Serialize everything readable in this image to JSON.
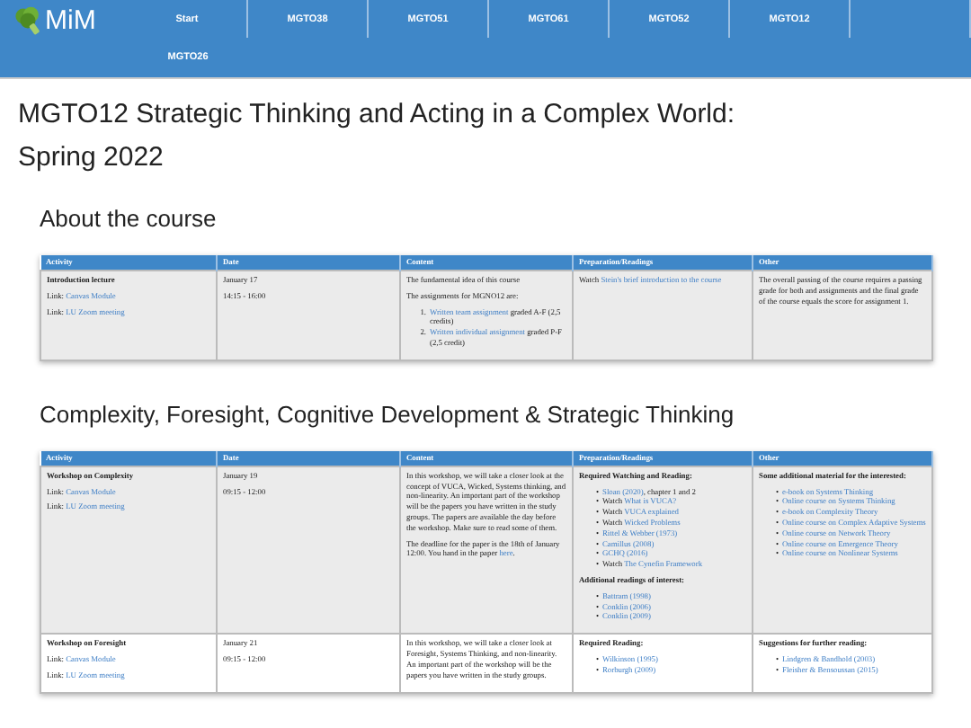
{
  "header": {
    "logo": "MiM",
    "nav": [
      "Start",
      "MGTO38",
      "MGTO51",
      "MGTO61",
      "MGTO52",
      "MGTO12",
      "MGTO26"
    ]
  },
  "title": "MGTO12 Strategic Thinking and Acting in a Complex World: Spring 2022",
  "sections": [
    {
      "heading": "About the course",
      "columns": [
        "Activity",
        "Date",
        "Content",
        "Preparation/Readings",
        "Other"
      ],
      "rows": [
        {
          "cells": [
            [
              {
                "kind": "bold",
                "text": "Introduction lecture"
              },
              {
                "kind": "para",
                "parts": [
                  {
                    "text": "Link: "
                  },
                  {
                    "text": "Canvas Module",
                    "link": true
                  }
                ]
              },
              {
                "kind": "para",
                "parts": [
                  {
                    "text": "Link: "
                  },
                  {
                    "text": "LU Zoom meeting",
                    "link": true
                  }
                ]
              }
            ],
            [
              {
                "kind": "para",
                "parts": [
                  {
                    "text": "January 17"
                  }
                ]
              },
              {
                "kind": "para",
                "parts": [
                  {
                    "text": "14:15 - 16:00"
                  }
                ]
              }
            ],
            [
              {
                "kind": "para",
                "parts": [
                  {
                    "text": "The fundamental idea of this course"
                  }
                ]
              },
              {
                "kind": "para",
                "parts": [
                  {
                    "text": "The assignments for MGNO12 are:"
                  }
                ]
              },
              {
                "kind": "ol",
                "markers": [
                  "1.",
                  "2."
                ],
                "items": [
                  [
                    {
                      "text": "Written team assignment",
                      "link": true
                    },
                    {
                      "text": " graded A-F (2,5 credits)"
                    }
                  ],
                  [
                    {
                      "text": "Written individual assignment",
                      "link": true
                    },
                    {
                      "text": " graded P-F (2,5 credit)"
                    }
                  ]
                ]
              }
            ],
            [
              {
                "kind": "para",
                "parts": [
                  {
                    "text": "Watch "
                  },
                  {
                    "text": "Stein's brief introduction to the course",
                    "link": true
                  }
                ]
              }
            ],
            [
              {
                "kind": "para",
                "parts": [
                  {
                    "text": "The overall passing of the course requires a passing grade for both and assignments and the final grade of the course equals the score for assignment 1."
                  }
                ]
              }
            ]
          ]
        }
      ]
    },
    {
      "heading": "Complexity, Foresight, Cognitive Development & Strategic Thinking",
      "columns": [
        "Activity",
        "Date",
        "Content",
        "Preparation/Readings",
        "Other"
      ],
      "rows": [
        {
          "cells": [
            [
              {
                "kind": "bold",
                "text": "Workshop on Complexity"
              },
              {
                "kind": "para",
                "parts": [
                  {
                    "text": "Link: "
                  },
                  {
                    "text": "Canvas Module",
                    "link": true
                  }
                ]
              },
              {
                "kind": "para",
                "parts": [
                  {
                    "text": "Link: "
                  },
                  {
                    "text": "LU Zoom meeting",
                    "link": true
                  }
                ]
              }
            ],
            [
              {
                "kind": "para",
                "parts": [
                  {
                    "text": "January 19"
                  }
                ]
              },
              {
                "kind": "para",
                "parts": [
                  {
                    "text": "09:15 - 12:00"
                  }
                ]
              }
            ],
            [
              {
                "kind": "para",
                "parts": [
                  {
                    "text": "In this workshop, we will take a closer look at the concept of VUCA, Wicked, Systems thinking, and non-linearity. An important part of the workshop will be the papers you have written in the study groups. The papers are available the day before the workshop. Make sure to read some of them."
                  }
                ]
              },
              {
                "kind": "para",
                "parts": [
                  {
                    "text": "The deadline for the paper is the 18th of January 12:00. You hand in the paper "
                  },
                  {
                    "text": "here",
                    "link": true
                  },
                  {
                    "text": "."
                  }
                ]
              }
            ],
            [
              {
                "kind": "bold",
                "text": "Required Watching and Reading:"
              },
              {
                "kind": "ul",
                "markers": [
                  "•",
                  "•",
                  "•",
                  "•",
                  "•",
                  "•",
                  "•",
                  "•"
                ],
                "items": [
                  [
                    {
                      "text": "Sloan (2020)",
                      "link": true
                    },
                    {
                      "text": ", chapter 1 and 2"
                    }
                  ],
                  [
                    {
                      "text": "Watch "
                    },
                    {
                      "text": "What is VUCA?",
                      "link": true
                    }
                  ],
                  [
                    {
                      "text": "Watch "
                    },
                    {
                      "text": "VUCA explained",
                      "link": true
                    }
                  ],
                  [
                    {
                      "text": "Watch "
                    },
                    {
                      "text": "Wicked Problems",
                      "link": true
                    }
                  ],
                  [
                    {
                      "text": "Rittel & Webber (1973)",
                      "link": true
                    }
                  ],
                  [
                    {
                      "text": "Camillus (2008)",
                      "link": true
                    }
                  ],
                  [
                    {
                      "text": "GCHQ (2016)",
                      "link": true
                    }
                  ],
                  [
                    {
                      "text": "Watch "
                    },
                    {
                      "text": "The Cynefin Framework",
                      "link": true
                    }
                  ]
                ]
              },
              {
                "kind": "bold",
                "text": "Additional readings of interest:"
              },
              {
                "kind": "ul",
                "markers": [
                  "•",
                  "•",
                  "•"
                ],
                "items": [
                  [
                    {
                      "text": "Battram (1998)",
                      "link": true
                    }
                  ],
                  [
                    {
                      "text": "Conklin (2006)",
                      "link": true
                    }
                  ],
                  [
                    {
                      "text": "Conklin (2009)",
                      "link": true
                    }
                  ]
                ]
              }
            ],
            [
              {
                "kind": "bold",
                "text": "Some additional material for the interested:"
              },
              {
                "kind": "ul",
                "markers": [
                  "•",
                  "•",
                  "•",
                  "•",
                  "•",
                  "•",
                  "•"
                ],
                "items": [
                  [
                    {
                      "text": "e-book on Systems Thinking",
                      "link": true
                    }
                  ],
                  [
                    {
                      "text": "Online course on Systems Thinking",
                      "link": true
                    }
                  ],
                  [
                    {
                      "text": "e-book on Complexity Theory",
                      "link": true
                    }
                  ],
                  [
                    {
                      "text": "Online course on Complex Adaptive Systems",
                      "link": true
                    }
                  ],
                  [
                    {
                      "text": "Online course on Network Theory",
                      "link": true
                    }
                  ],
                  [
                    {
                      "text": "Online course on Emergence Theory",
                      "link": true
                    }
                  ],
                  [
                    {
                      "text": "Online course on Nonlinear Systems",
                      "link": true
                    }
                  ]
                ]
              }
            ]
          ]
        },
        {
          "cells": [
            [
              {
                "kind": "bold",
                "text": "Workshop on Foresight"
              },
              {
                "kind": "para",
                "parts": [
                  {
                    "text": "Link: "
                  },
                  {
                    "text": "Canvas Module",
                    "link": true
                  }
                ]
              },
              {
                "kind": "para",
                "parts": [
                  {
                    "text": "Link: "
                  },
                  {
                    "text": "LU Zoom meeting",
                    "link": true
                  }
                ]
              }
            ],
            [
              {
                "kind": "para",
                "parts": [
                  {
                    "text": "January 21"
                  }
                ]
              },
              {
                "kind": "para",
                "parts": [
                  {
                    "text": "09:15 - 12:00"
                  }
                ]
              }
            ],
            [
              {
                "kind": "para",
                "parts": [
                  {
                    "text": "In this workshop, we will take a closer look at Foresight, Systems Thinking, and non-linearity. An important part of the workshop will be the papers you have written in the study groups."
                  }
                ]
              }
            ],
            [
              {
                "kind": "bold",
                "text": "Required Reading:"
              },
              {
                "kind": "ul",
                "markers": [
                  "•",
                  "•"
                ],
                "items": [
                  [
                    {
                      "text": "Wilkinson (1995)",
                      "link": true
                    }
                  ],
                  [
                    {
                      "text": "Rorburgh (2009)",
                      "link": true
                    }
                  ]
                ]
              }
            ],
            [
              {
                "kind": "bold",
                "text": "Suggestions for further reading:"
              },
              {
                "kind": "ul",
                "markers": [
                  "•",
                  "•"
                ],
                "items": [
                  [
                    {
                      "text": "Lindgren & Bandhold (2003)",
                      "link": true
                    }
                  ],
                  [
                    {
                      "text": "Fleisher & Bensoussan (2015)",
                      "link": true
                    }
                  ]
                ]
              }
            ]
          ]
        }
      ]
    }
  ]
}
